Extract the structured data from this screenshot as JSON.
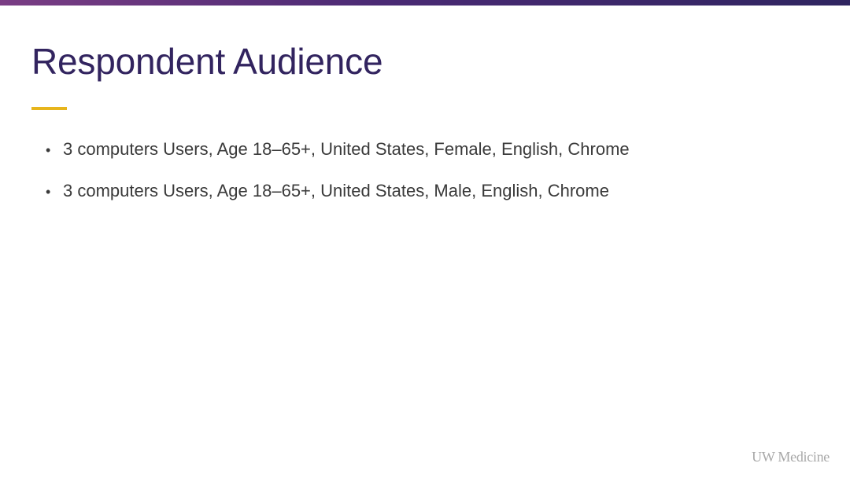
{
  "slide": {
    "title": "Respondent Audience",
    "bullets": [
      "3 computers Users, Age 18–65+, United States, Female, English, Chrome",
      "3 computers Users, Age 18–65+, United States, Male, English, Chrome"
    ],
    "bullet_symbol": "•",
    "logo_text": "UW Medicine"
  },
  "colors": {
    "title": "#32245f",
    "accent": "#e7b51c",
    "top_bar_start": "#7a3d84",
    "top_bar_end": "#2f2560",
    "body_text": "#3a3a3a",
    "logo": "#a8a8a8"
  }
}
